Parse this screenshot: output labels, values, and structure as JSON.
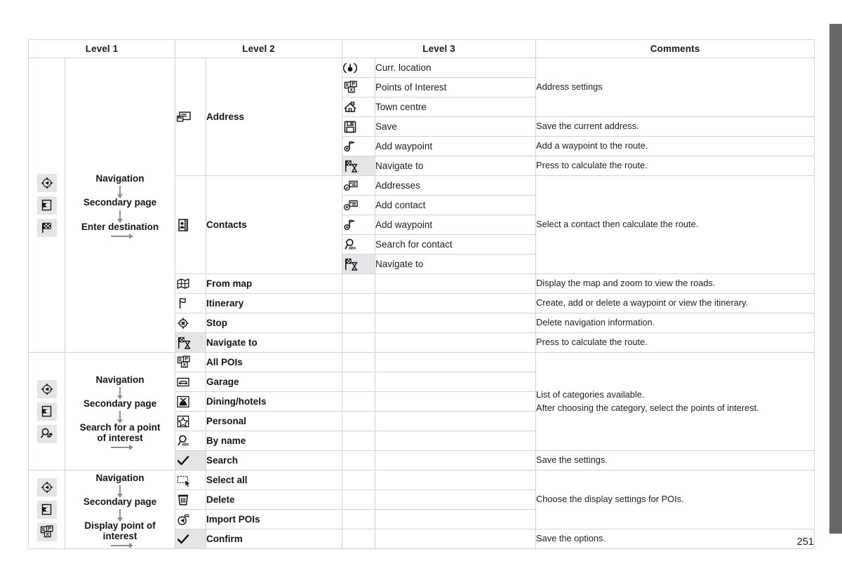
{
  "page": {
    "number": "251"
  },
  "table": {
    "headers": [
      "Level 1",
      "Level 2",
      "Level 3",
      "Comments"
    ],
    "sections": [
      {
        "level1": {
          "icons": [
            "navigation-compass-icon",
            "secondary-page-icon",
            "checkered-flag-icon"
          ],
          "flow": [
            "Navigation",
            "Secondary page",
            "Enter destination"
          ]
        },
        "groups": [
          {
            "level2": {
              "icon": "address-card-icon",
              "label": "Address"
            },
            "level3": [
              {
                "icon": "current-location-icon",
                "label": "Curr. location"
              },
              {
                "icon": "points-of-interest-icon",
                "label": "Points of Interest"
              },
              {
                "icon": "town-centre-icon",
                "label": "Town centre"
              },
              {
                "icon": "floppy-save-icon",
                "label": "Save"
              },
              {
                "icon": "add-waypoint-icon",
                "label": "Add waypoint"
              },
              {
                "icon": "navigate-to-icon",
                "label": "Navigate to",
                "shaded": true
              }
            ],
            "comments": [
              {
                "text": "Address settings",
                "rows": 3
              },
              {
                "text": "Save the current address.",
                "rows": 1
              },
              {
                "text": "Add a waypoint to the route.",
                "rows": 1
              },
              {
                "text": "Press to calculate the route.",
                "rows": 1
              }
            ]
          },
          {
            "level2": {
              "icon": "contacts-book-icon",
              "label": "Contacts"
            },
            "level3": [
              {
                "icon": "addresses-icon",
                "label": "Addresses"
              },
              {
                "icon": "add-contact-icon",
                "label": "Add contact"
              },
              {
                "icon": "add-waypoint-icon",
                "label": "Add waypoint"
              },
              {
                "icon": "search-contact-icon",
                "label": "Search for contact"
              },
              {
                "icon": "navigate-to-icon",
                "label": "Navigate to",
                "shaded": true
              }
            ],
            "comments": [
              {
                "text": "Select a contact then calculate the route.",
                "rows": 5
              }
            ]
          }
        ],
        "simple_rows": [
          {
            "icon": "from-map-icon",
            "label": "From map",
            "comment": "Display the map and zoom to view the roads."
          },
          {
            "icon": "itinerary-flag-icon",
            "label": "Itinerary",
            "comment": "Create, add or delete a waypoint or view the itinerary."
          },
          {
            "icon": "stop-navigation-icon",
            "label": "Stop",
            "comment": "Delete navigation information."
          },
          {
            "icon": "navigate-to-icon",
            "label": "Navigate to",
            "comment": "Press to calculate the route.",
            "shaded": true
          }
        ]
      },
      {
        "level1": {
          "icons": [
            "navigation-compass-icon",
            "secondary-page-icon",
            "search-poi-icon"
          ],
          "flow": [
            "Navigation",
            "Secondary page",
            "Search for a point\nof interest"
          ]
        },
        "simple_rows": [
          {
            "icon": "all-pois-icon",
            "label": "All POIs"
          },
          {
            "icon": "garage-icon",
            "label": "Garage"
          },
          {
            "icon": "dining-hotels-icon",
            "label": "Dining/hotels"
          },
          {
            "icon": "personal-star-icon",
            "label": "Personal"
          },
          {
            "icon": "by-name-icon",
            "label": "By name"
          },
          {
            "icon": "check-icon",
            "label": "Search",
            "shaded": true
          }
        ],
        "comments": [
          {
            "text": "List of categories available.\nAfter choosing the category, select the points of interest.",
            "rows": 5
          },
          {
            "text": "Save the settings.",
            "rows": 1
          }
        ]
      },
      {
        "level1": {
          "icons": [
            "navigation-compass-icon",
            "secondary-page-icon",
            "points-of-interest-icon"
          ],
          "flow": [
            "Navigation",
            "Secondary page",
            "Display point of\ninterest"
          ]
        },
        "simple_rows": [
          {
            "icon": "select-all-icon",
            "label": "Select all"
          },
          {
            "icon": "trash-delete-icon",
            "label": "Delete"
          },
          {
            "icon": "import-pois-icon",
            "label": "Import POIs"
          },
          {
            "icon": "check-icon",
            "label": "Confirm",
            "shaded": true
          }
        ],
        "comments": [
          {
            "text": "Choose the display settings for POIs.",
            "rows": 3
          },
          {
            "text": "Save the options.",
            "rows": 1
          }
        ]
      }
    ]
  },
  "colors": {
    "header_bg": "#e9eaeb",
    "comment_bg": "#e9eaeb",
    "icon_shade": "#e4e5e6",
    "border": "#d2d3d5",
    "side_bar": "#666769"
  }
}
